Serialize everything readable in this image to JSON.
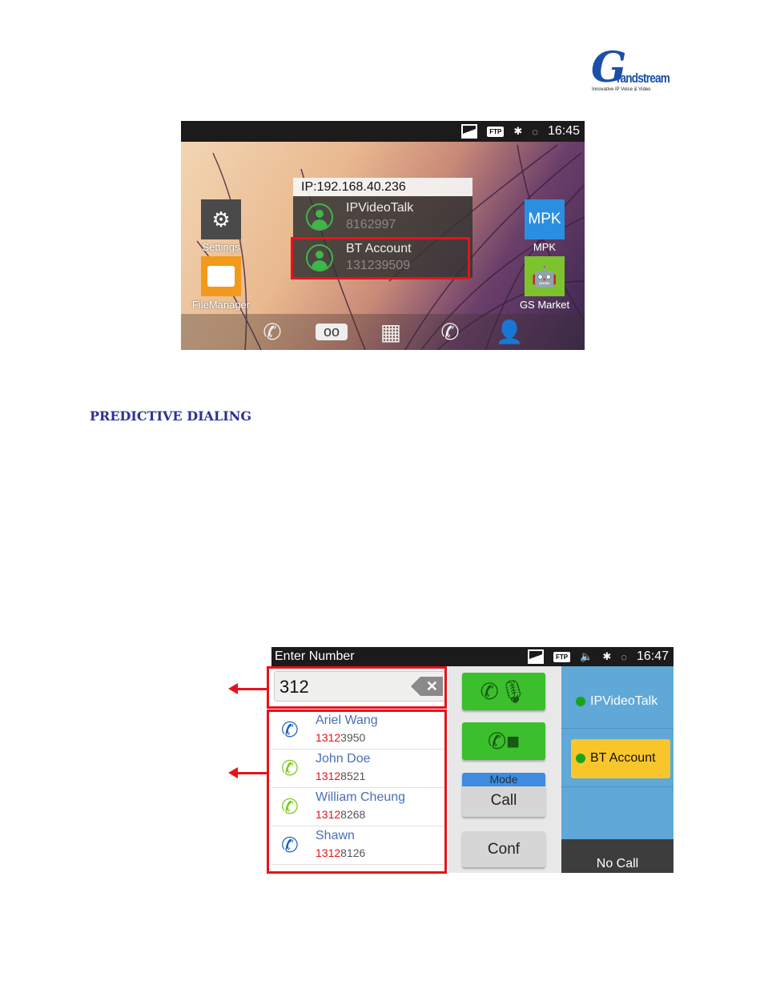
{
  "logo": {
    "brand": "Grandstream",
    "tagline": "Innovative IP Voice & Video"
  },
  "screen1": {
    "status": {
      "time": "16:45",
      "icons": [
        "picture-icon",
        "ftp-icon",
        "bluetooth-icon",
        "sync-icon"
      ],
      "ftp": "FTP"
    },
    "popup": {
      "ip": "IP:192.168.40.236",
      "accounts": [
        {
          "name": "IPVideoTalk",
          "number": "8162997"
        },
        {
          "name": "BT Account",
          "number": "131239509"
        }
      ]
    },
    "apps": [
      {
        "label": "Settings",
        "color": "#4a4a4a"
      },
      {
        "label": "FileManager",
        "color": "#f29a1c"
      },
      {
        "label": "MPK",
        "icon_text": "MPK",
        "color": "#2a8fe0"
      },
      {
        "label": "GS Market",
        "color": "#7cc32d"
      }
    ],
    "dock": [
      "phone-icon",
      "voicemail-icon",
      "apps-grid-icon",
      "call-history-icon",
      "contacts-icon"
    ]
  },
  "heading": "PREDICTIVE DIALING",
  "screen2": {
    "title": "Enter Number",
    "status": {
      "time": "16:47",
      "ftp": "FTP"
    },
    "input": "312",
    "results": [
      {
        "name": "Ariel Wang",
        "match": "1312",
        "rest": "3950",
        "type": "incoming",
        "color": "#1c63c4"
      },
      {
        "name": "John Doe",
        "match": "1312",
        "rest": "8521",
        "type": "outgoing",
        "color": "#7cc81c"
      },
      {
        "name": "William Cheung",
        "match": "1312",
        "rest": "8268",
        "type": "outgoing",
        "color": "#7cc81c"
      },
      {
        "name": "Shawn",
        "match": "1312",
        "rest": "8126",
        "type": "incoming",
        "color": "#1c63c4"
      }
    ],
    "mode": {
      "label": "Mode",
      "value": "Call"
    },
    "conf": "Conf",
    "accounts": [
      {
        "name": "IPVideoTalk",
        "selected": false
      },
      {
        "name": "BT Account",
        "selected": true
      }
    ],
    "nocall": "No Call"
  }
}
